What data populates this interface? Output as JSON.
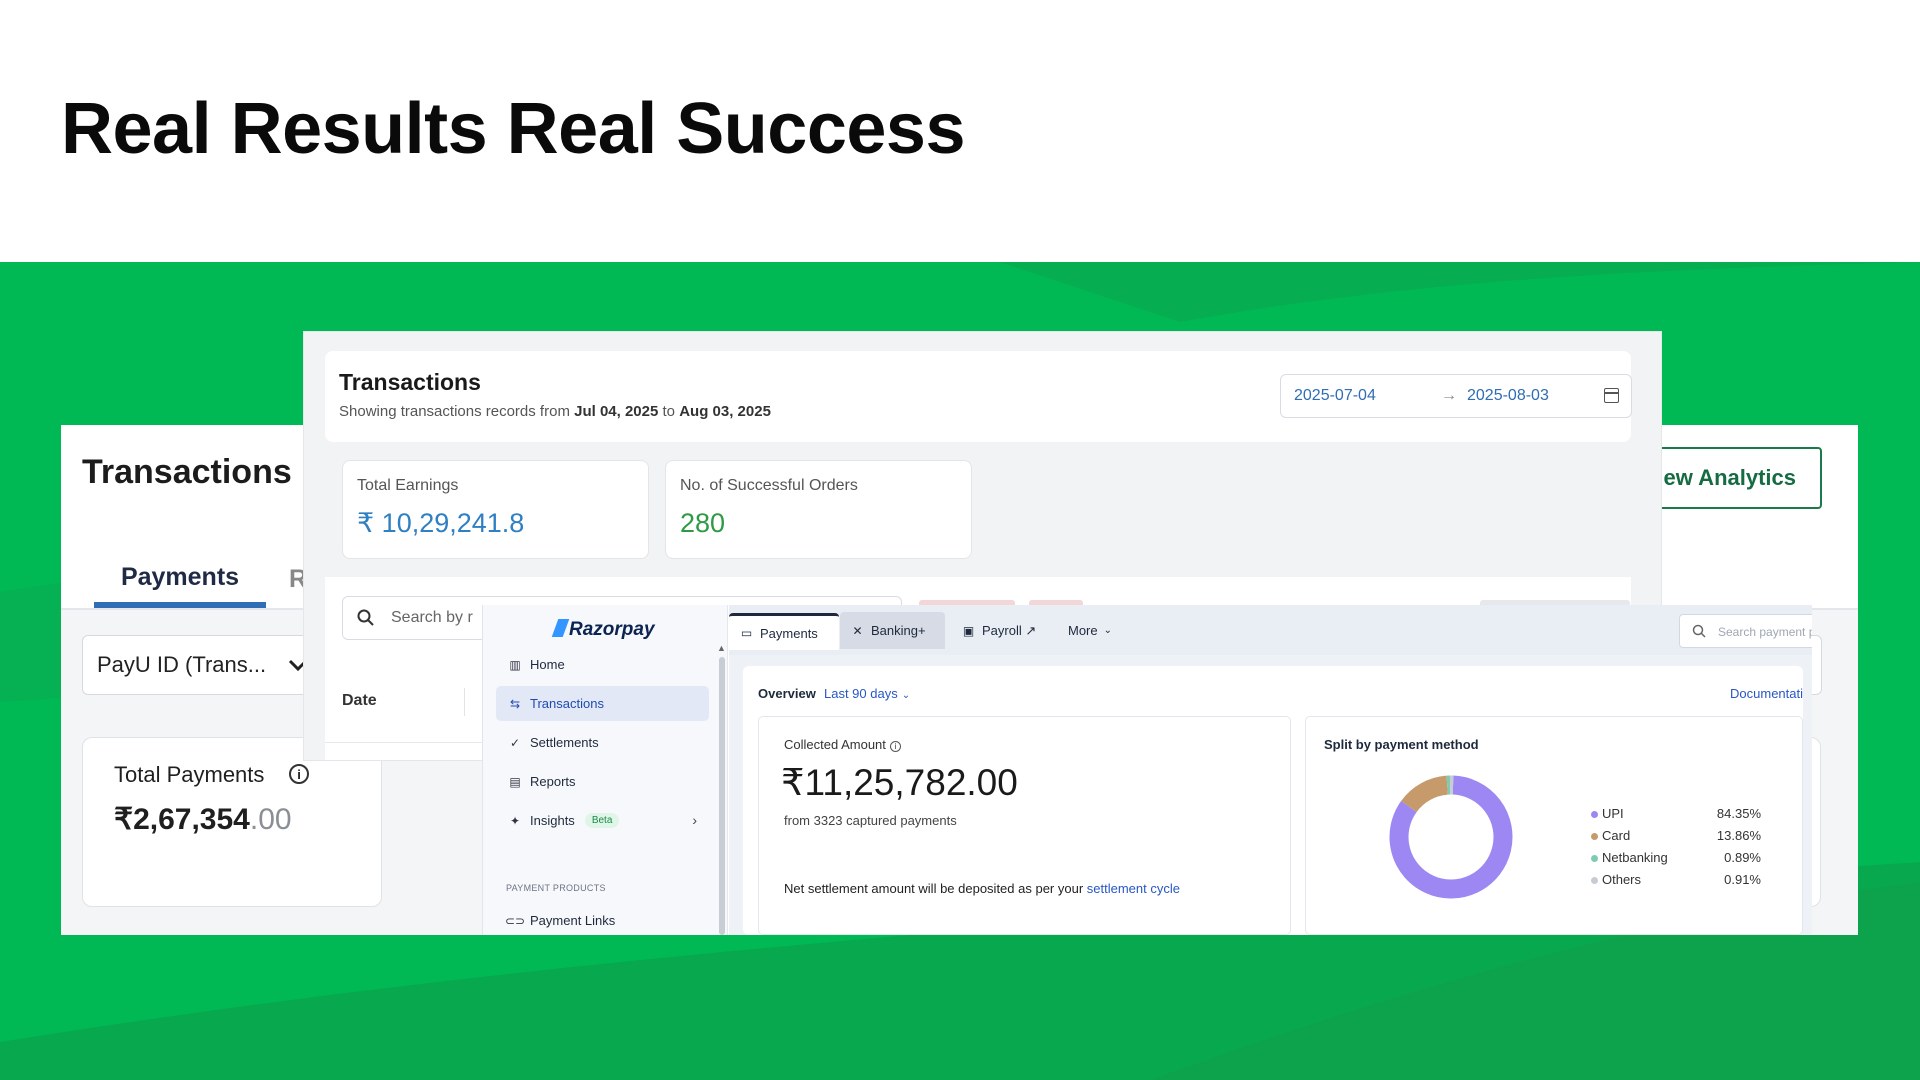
{
  "headline": "Real Results Real Success",
  "back_panel": {
    "title": "Transactions",
    "view_analytics": "ew Analytics",
    "tabs": [
      "Payments",
      "R"
    ],
    "select_value": "PayU ID (Trans...",
    "total_label": "Total Payments",
    "total_info_icon": "i",
    "total_value_main": "₹2,67,354",
    "total_value_dec": ".00"
  },
  "mid_panel": {
    "title": "Transactions",
    "subtitle_prefix": "Showing transactions records from ",
    "subtitle_from": "Jul 04, 2025",
    "subtitle_to_word": " to ",
    "subtitle_to": "Aug 03, 2025",
    "date_from": "2025-07-04",
    "date_arrow": "→",
    "date_to": "2025-08-03",
    "earnings_label": "Total Earnings",
    "earnings_value": "₹ 10,29,241.8",
    "orders_label": "No. of Successful Orders",
    "orders_value": "280",
    "search_placeholder": "Search by r",
    "column_date": "Date",
    "accent_colors": {
      "earnings": "#2f7fc1",
      "orders": "#2e9a45"
    }
  },
  "razorpay": {
    "logo": "Razorpay",
    "nav": [
      {
        "label": "Home",
        "icon": "home-icon",
        "glyph": "▥"
      },
      {
        "label": "Transactions",
        "icon": "transactions-icon",
        "glyph": "⇆"
      },
      {
        "label": "Settlements",
        "icon": "settlements-icon",
        "glyph": "✓"
      },
      {
        "label": "Reports",
        "icon": "reports-icon",
        "glyph": "▤"
      },
      {
        "label": "Insights",
        "icon": "insights-icon",
        "glyph": "✦"
      },
      {
        "label": "Payment Links",
        "icon": "link-icon",
        "glyph": "⊂⊃"
      }
    ],
    "beta_badge": "Beta",
    "section_label": "PAYMENT PRODUCTS",
    "tabs": {
      "payments": "Payments",
      "banking": "Banking+",
      "payroll": "Payroll ↗",
      "more": "More"
    },
    "search_placeholder": "Search payment products, settings, and more",
    "overview_label": "Overview",
    "overview_range": "Last 90 days",
    "documentation": "Documentati",
    "collected_label": "Collected Amount",
    "collected_value": "₹11,25,782.00",
    "collected_sub": "from 3323 captured payments",
    "net_text": "Net settlement amount will be deposited as per your ",
    "net_link": "settlement cycle",
    "split_title": "Split by payment method",
    "brand_color": "#3395ff"
  },
  "chart_data": {
    "type": "pie",
    "title": "Split by payment method",
    "categories": [
      "UPI",
      "Card",
      "Netbanking",
      "Others"
    ],
    "values": [
      84.35,
      13.86,
      0.89,
      0.91
    ],
    "labels": [
      "84.35%",
      "13.86%",
      "0.89%",
      "0.91%"
    ],
    "colors": [
      "#9d87f3",
      "#c79a6c",
      "#7fcbb0",
      "#c8cbd3"
    ],
    "legend": "right"
  }
}
